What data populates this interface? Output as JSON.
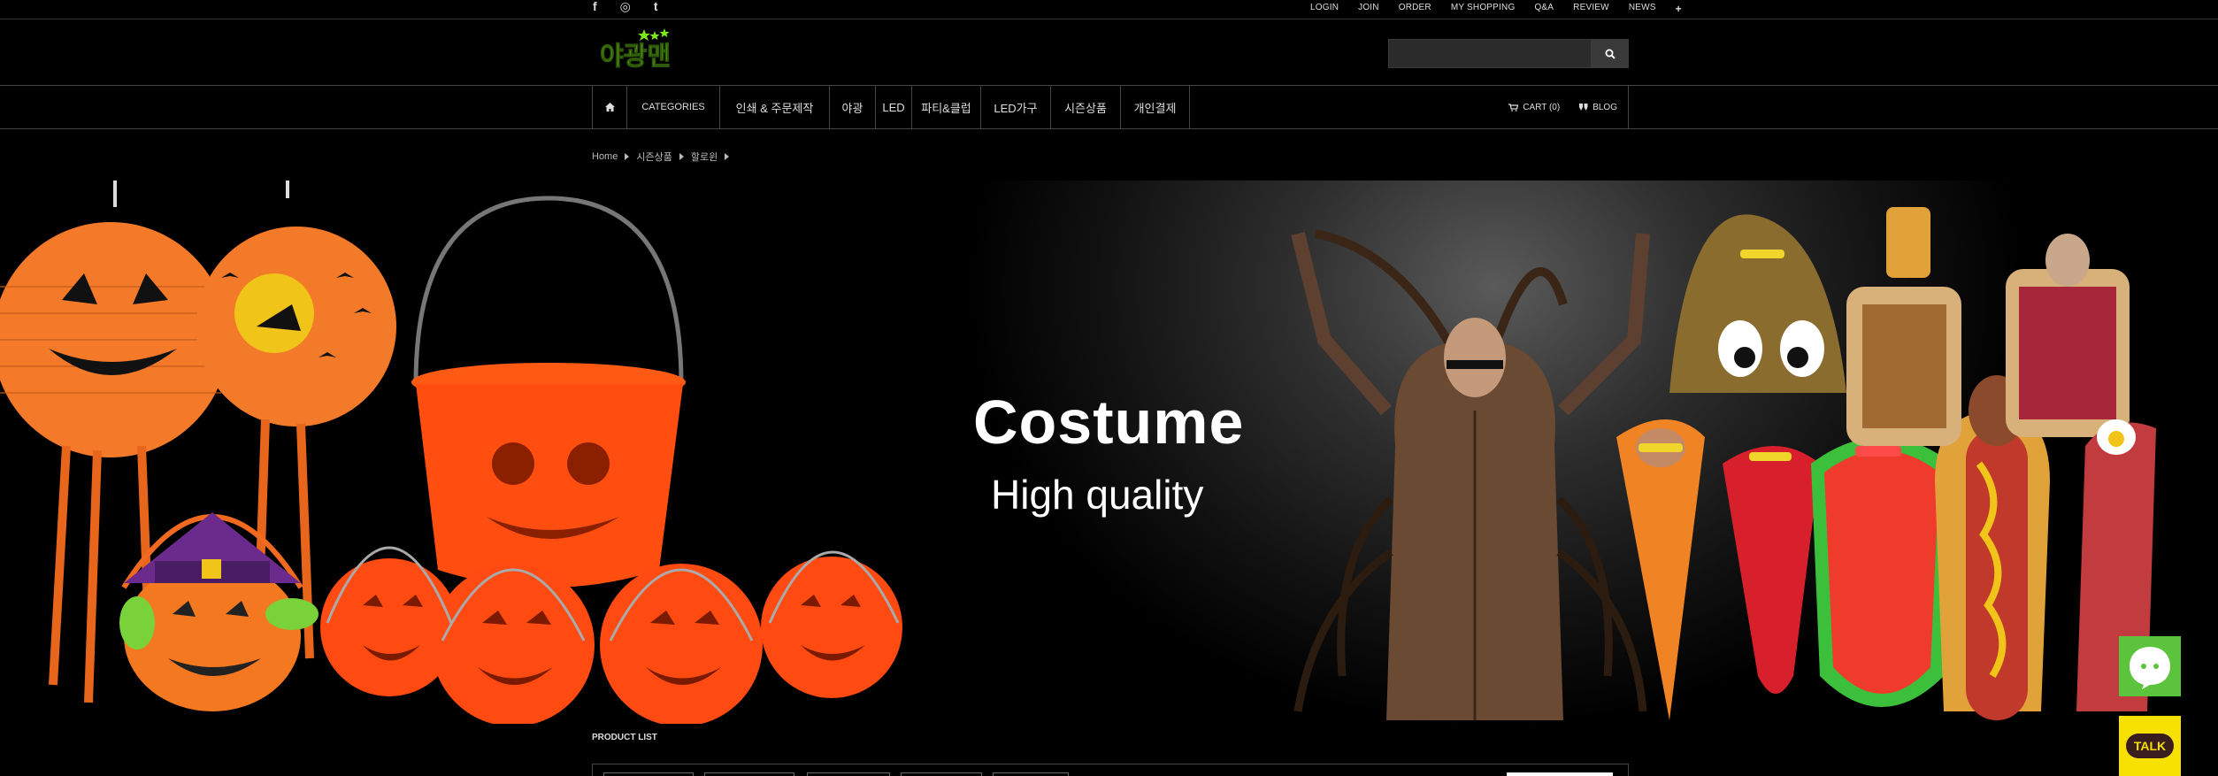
{
  "social": {
    "facebook": "f",
    "instagram": "◎",
    "tumblr": "t"
  },
  "topnav": [
    "LOGIN",
    "JOIN",
    "ORDER",
    "MY SHOPPING",
    "Q&A",
    "REVIEW",
    "NEWS",
    "+"
  ],
  "logo": {
    "text": "야광맨"
  },
  "search": {
    "placeholder": ""
  },
  "nav": {
    "categories": "CATEGORIES",
    "items": [
      "인쇄 & 주문제작",
      "야광",
      "LED",
      "파티&클럽",
      "LED가구",
      "시즌상품",
      "개인결제"
    ],
    "cart": "CART (0)",
    "blog": "BLOG"
  },
  "breadcrumb": [
    "Home",
    "시즌상품",
    "할로윈"
  ],
  "banner": {
    "title": "Costume",
    "subtitle": "High quality"
  },
  "product_list": {
    "title": "PRODUCT LIST"
  },
  "floating": {
    "talk": "TALK"
  },
  "colors": {
    "accent_green": "#5cc33d",
    "logo_green": "#7be81c",
    "kakao_yellow": "#f7e100",
    "pumpkin": "#ff6a1a"
  }
}
